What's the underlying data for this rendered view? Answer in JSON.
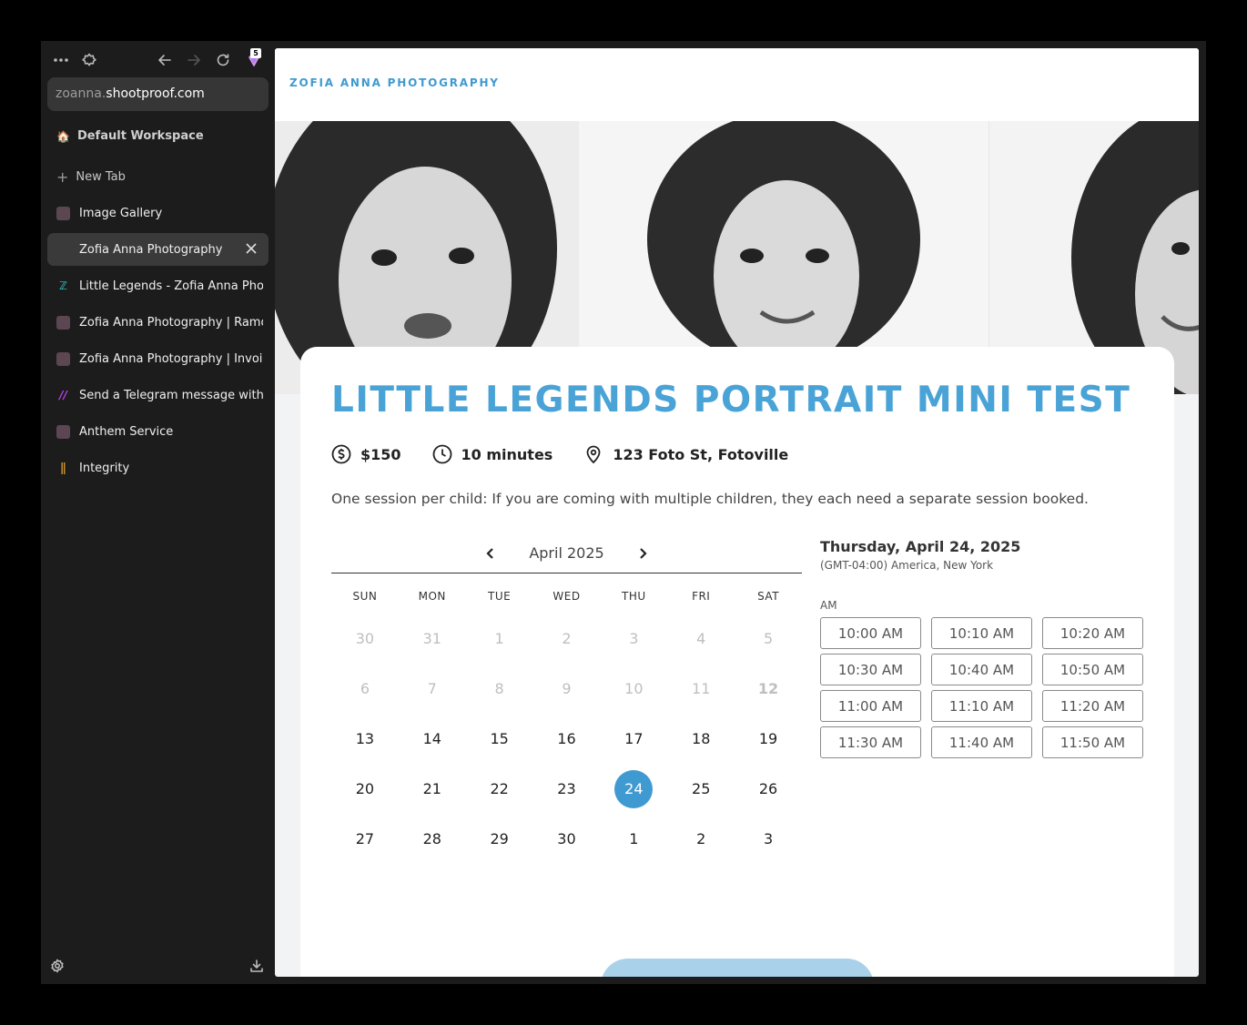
{
  "browser": {
    "ext_badge_count": "5",
    "url_sub": "zoanna.",
    "url_domain": "shootproof.com",
    "workspace": "Default Workspace",
    "new_tab": "New Tab",
    "tabs": [
      {
        "label": "Image Gallery"
      },
      {
        "label": "Zofia Anna Photography"
      },
      {
        "label": "Little Legends - Zofia Anna Photography"
      },
      {
        "label": "Zofia Anna Photography | Ramona"
      },
      {
        "label": "Zofia Anna Photography | Invoice"
      },
      {
        "label": "Send a Telegram message with Make"
      },
      {
        "label": "Anthem Service"
      },
      {
        "label": "Integrity"
      }
    ]
  },
  "site": {
    "brand": "ZOFIA ANNA PHOTOGRAPHY"
  },
  "session": {
    "title": "LITTLE LEGENDS PORTRAIT MINI TEST",
    "price": "$150",
    "duration": "10 minutes",
    "location": "123 Foto St, Fotoville",
    "description": "One session per child: If you are coming with multiple children, they each need a separate session booked."
  },
  "calendar": {
    "month": "April 2025",
    "dow": [
      "SUN",
      "MON",
      "TUE",
      "WED",
      "THU",
      "FRI",
      "SAT"
    ],
    "days": [
      "30",
      "31",
      "1",
      "2",
      "3",
      "4",
      "5",
      "6",
      "7",
      "8",
      "9",
      "10",
      "11",
      "12",
      "13",
      "14",
      "15",
      "16",
      "17",
      "18",
      "19",
      "20",
      "21",
      "22",
      "23",
      "24",
      "25",
      "26",
      "27",
      "28",
      "29",
      "30",
      "1",
      "2",
      "3"
    ],
    "selected": "24"
  },
  "slots": {
    "date": "Thursday, April 24, 2025",
    "timezone": "(GMT-04:00) America, New York",
    "period": "AM",
    "times": [
      "10:00 AM",
      "10:10 AM",
      "10:20 AM",
      "10:30 AM",
      "10:40 AM",
      "10:50 AM",
      "11:00 AM",
      "11:10 AM",
      "11:20 AM",
      "11:30 AM",
      "11:40 AM",
      "11:50 AM"
    ]
  },
  "colors": {
    "accent": "#3f9ad1",
    "title": "#4aa3d6",
    "sidebar_bg": "#1c1c1c"
  }
}
